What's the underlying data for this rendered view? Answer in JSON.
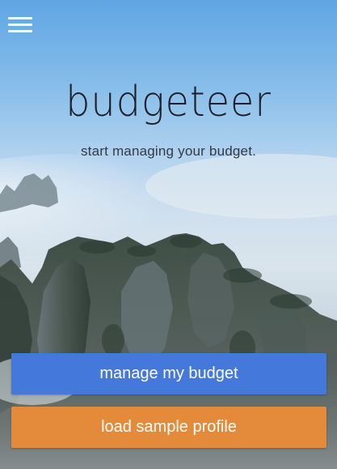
{
  "header": {
    "menu_icon": "hamburger-menu-icon"
  },
  "hero": {
    "title": "budgeteer",
    "tagline": "start managing your budget."
  },
  "actions": {
    "manage_label": "manage my budget",
    "sample_label": "load sample profile"
  },
  "colors": {
    "primary_button": "#4479db",
    "secondary_button": "#e38b3b",
    "title_text": "#1c1f2a"
  }
}
